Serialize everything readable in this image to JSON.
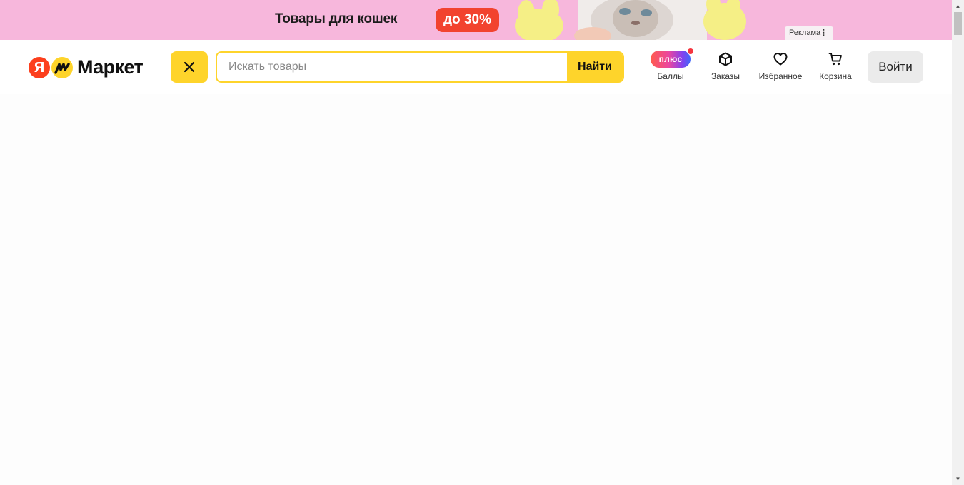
{
  "banner": {
    "text": "Товары для кошек",
    "badge": "до 30%",
    "ad_label": "Реклама",
    "ad_menu": "⋮",
    "colors": {
      "background": "#f7b7dc",
      "badge": "#f2432f"
    }
  },
  "header": {
    "logo": {
      "ya_letter": "Я",
      "text": "Маркет"
    },
    "search": {
      "placeholder": "Искать товары",
      "value": "",
      "button_label": "Найти"
    },
    "nav": {
      "points": {
        "badge": "плюс",
        "label": "Баллы"
      },
      "orders": {
        "label": "Заказы"
      },
      "favorites": {
        "label": "Избранное"
      },
      "cart": {
        "label": "Корзина"
      }
    },
    "login_label": "Войти",
    "colors": {
      "accent": "#fed42b",
      "brand_red": "#fc3f1d"
    }
  },
  "icons": {
    "close": "close-icon",
    "orders": "box-icon",
    "favorites": "heart-icon",
    "cart": "cart-icon"
  }
}
